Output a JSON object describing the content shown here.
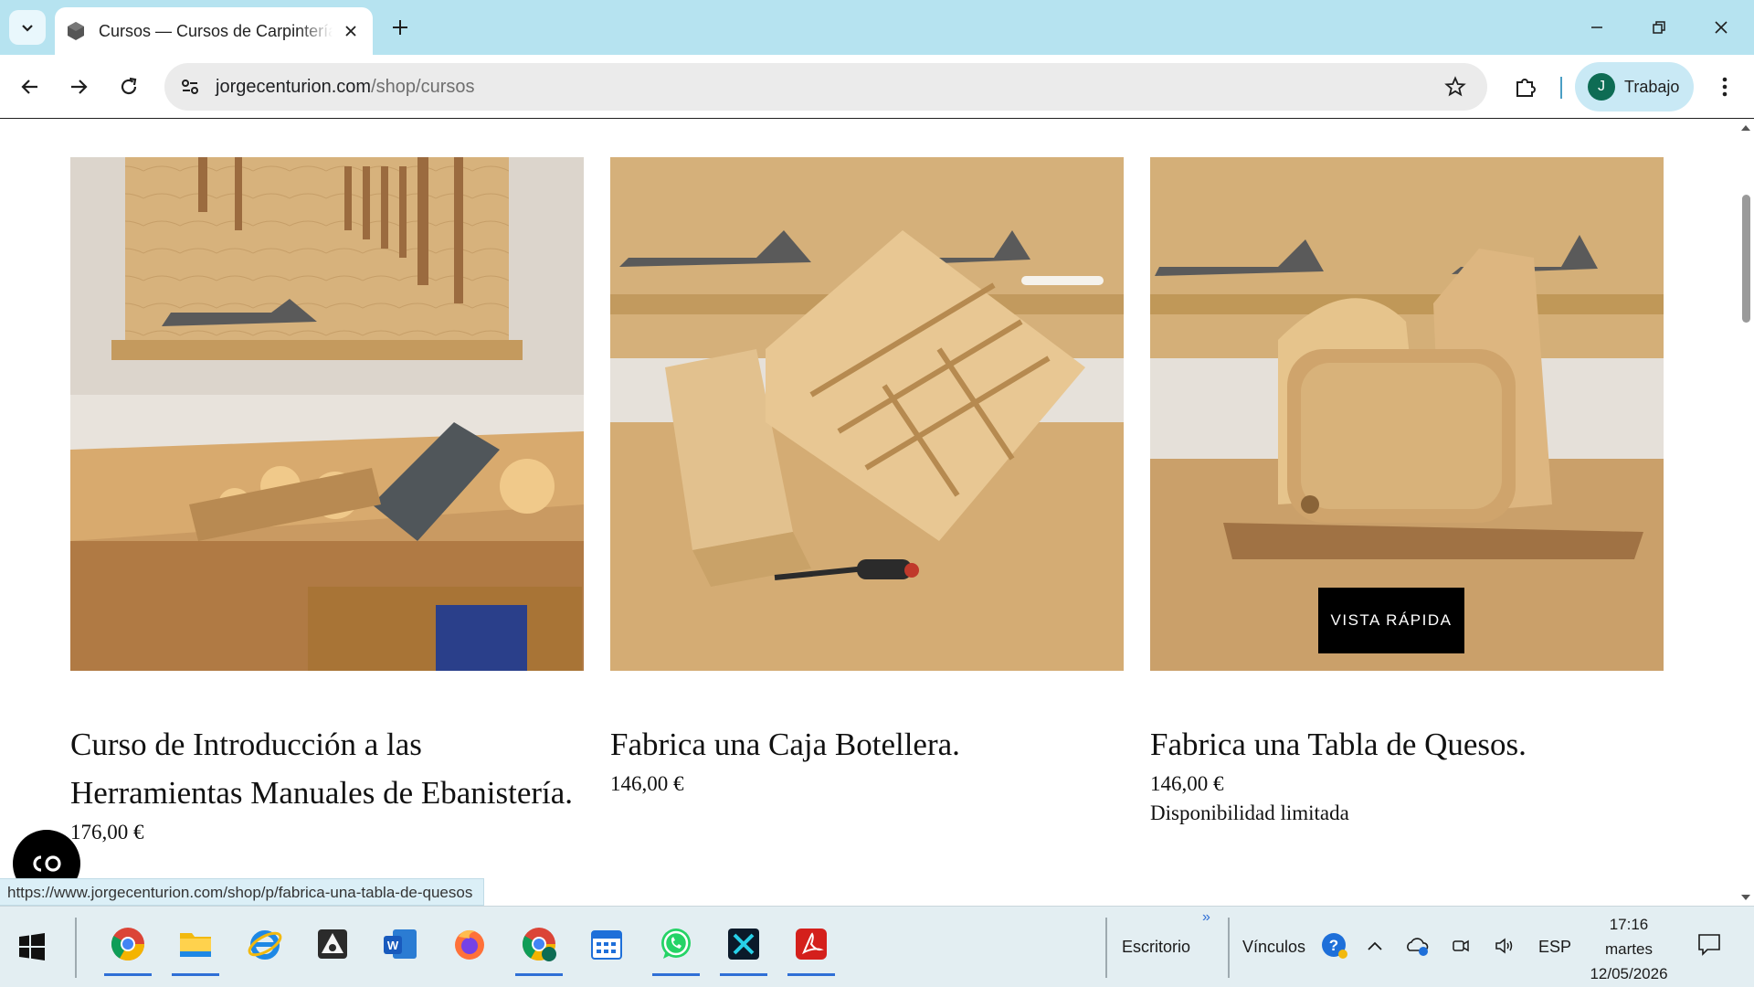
{
  "browser": {
    "tab": {
      "title": "Cursos — Cursos de Carpintería",
      "close_icon": "close-icon"
    },
    "address_bar": {
      "domain": "jorgecenturion.com",
      "path": "/shop/cursos"
    },
    "profile": {
      "initial": "J",
      "name": "Trabajo",
      "avatar_color": "#0e6c54"
    },
    "accent_color": "#b6e3f0"
  },
  "products": [
    {
      "title": "Curso de Introducción a las Herramientas Manuales de Ebanistería.",
      "price": "176,00 €"
    },
    {
      "title": "Fabrica una Caja Botellera.",
      "price": "146,00 €"
    },
    {
      "title": "Fabrica una Tabla de Quesos.",
      "price": "146,00 €",
      "note": "Disponibilidad limitada",
      "quick_view_label": "VISTA RÁPIDA"
    }
  ],
  "status_bar": {
    "url": "https://www.jorgecenturion.com/shop/p/fabrica-una-tabla-de-quesos"
  },
  "taskbar": {
    "apps": [
      "chrome-icon",
      "file-explorer-icon",
      "internet-explorer-icon",
      "inkscape-icon",
      "word-icon",
      "firefox-icon",
      "chrome-profile-icon",
      "calendar-icon",
      "whatsapp-icon",
      "unknown-app-icon",
      "acrobat-icon"
    ],
    "toolbar_desktop": "Escritorio",
    "toolbar_links": "Vínculos",
    "chevron": "»",
    "language": "ESP",
    "time": "17:16",
    "day": "martes",
    "date": "12/05/2026"
  }
}
